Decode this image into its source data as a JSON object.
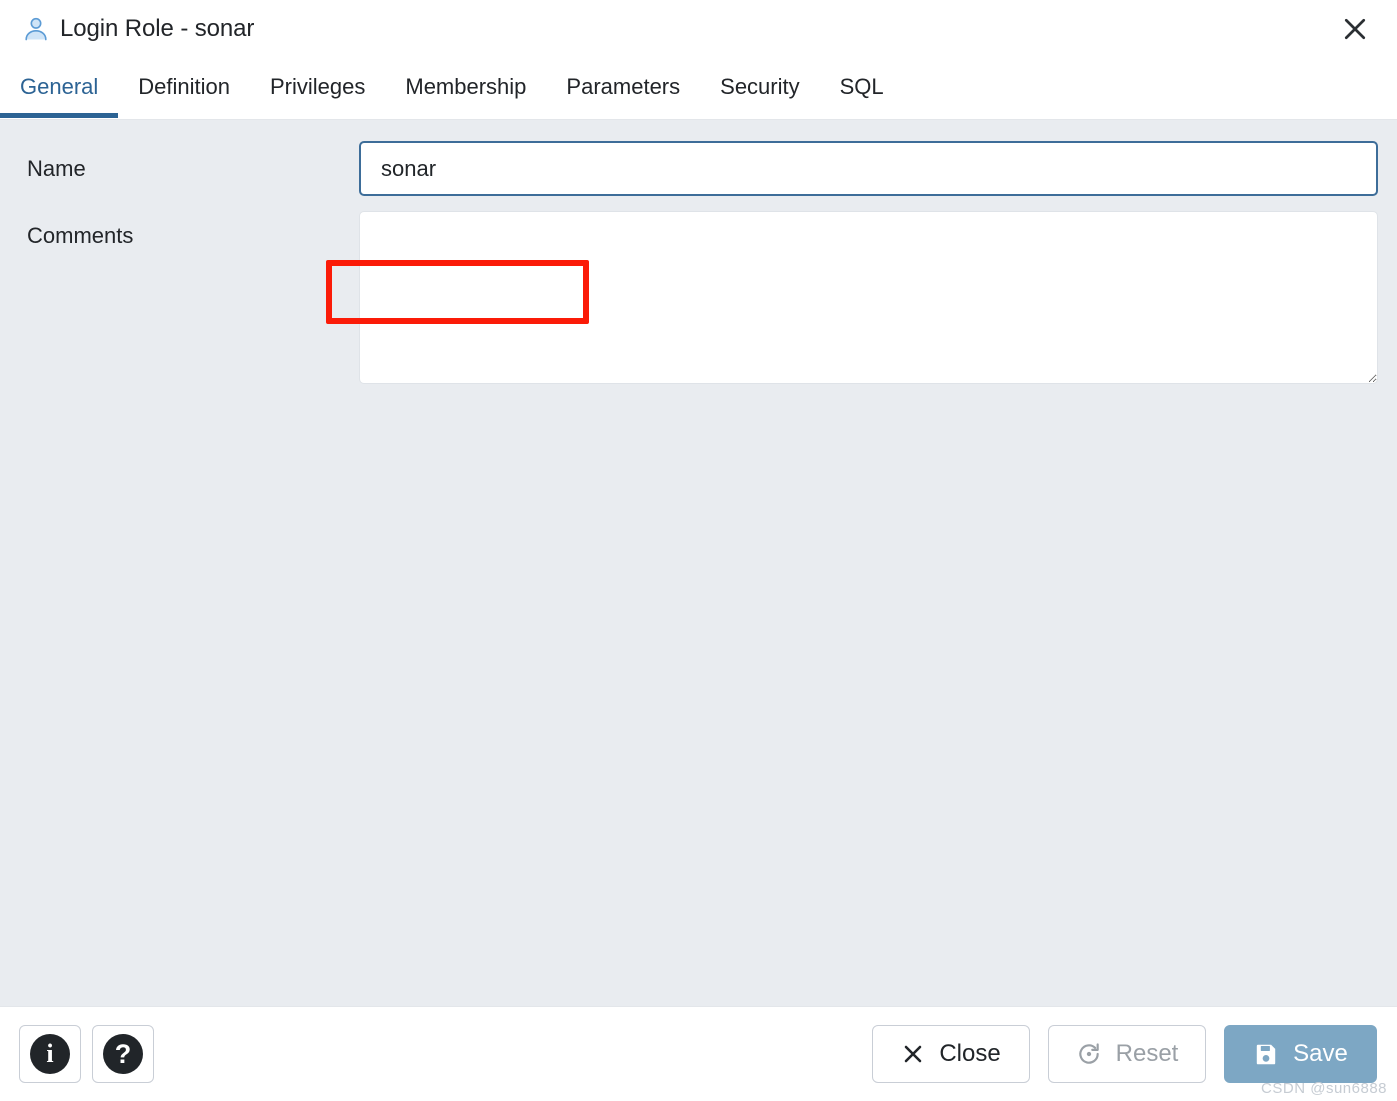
{
  "window": {
    "title": "Login Role - sonar",
    "icon": "user-role-icon",
    "close_icon": "close-icon",
    "accent_color": "#2c6394"
  },
  "tabs": [
    {
      "label": "General",
      "active": true
    },
    {
      "label": "Definition",
      "active": false
    },
    {
      "label": "Privileges",
      "active": false
    },
    {
      "label": "Membership",
      "active": false
    },
    {
      "label": "Parameters",
      "active": false
    },
    {
      "label": "Security",
      "active": false
    },
    {
      "label": "SQL",
      "active": false
    }
  ],
  "form": {
    "name": {
      "label": "Name",
      "value": "sonar",
      "placeholder": ""
    },
    "comments": {
      "label": "Comments",
      "value": "",
      "placeholder": ""
    }
  },
  "annotation": {
    "type": "highlight-rectangle",
    "color": "#fb1b08",
    "target": "name-input"
  },
  "footer": {
    "info_button": {
      "icon": "info-icon",
      "label": ""
    },
    "help_button": {
      "icon": "help-icon",
      "label": ""
    },
    "close_button": {
      "label": "Close",
      "icon": "close-x-icon",
      "disabled": false
    },
    "reset_button": {
      "label": "Reset",
      "icon": "reset-icon",
      "disabled": true
    },
    "save_button": {
      "label": "Save",
      "icon": "save-floppy-icon",
      "disabled": true,
      "color": "#7da7c4"
    }
  },
  "watermark": {
    "text": "CSDN @sun6888"
  }
}
